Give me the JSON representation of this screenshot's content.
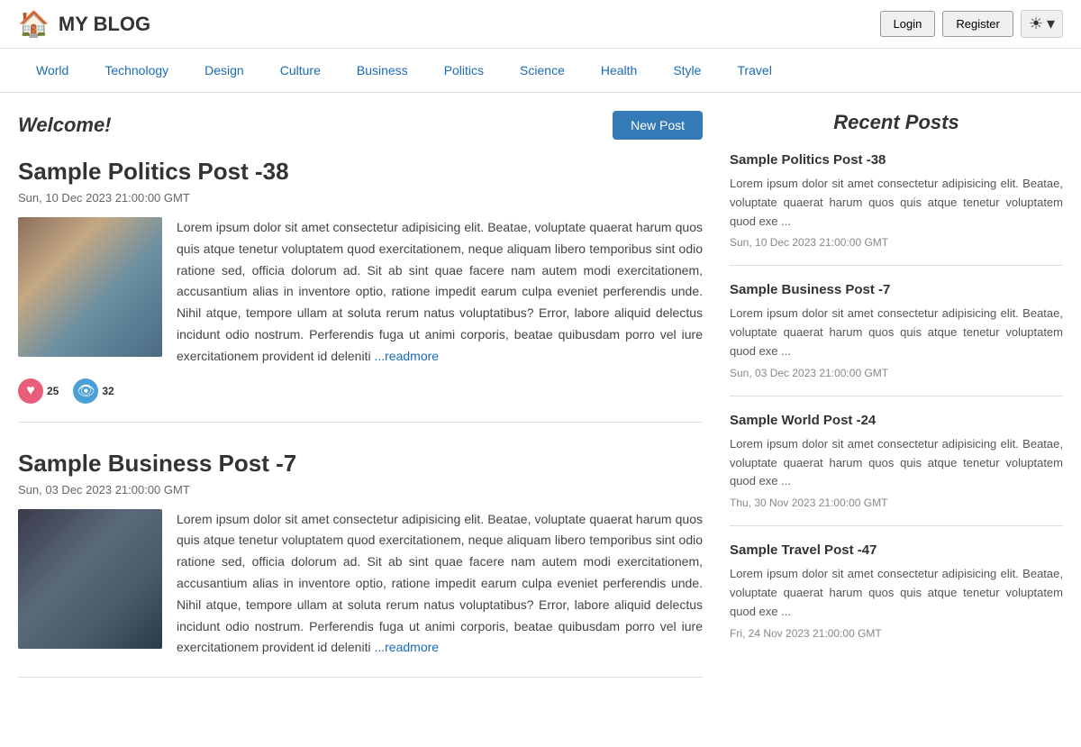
{
  "header": {
    "logo_icon": "🏠",
    "title": "MY BLOG",
    "login_label": "Login",
    "register_label": "Register",
    "theme_icon": "☀",
    "theme_chevron": "▾"
  },
  "nav": {
    "items": [
      {
        "label": "World"
      },
      {
        "label": "Technology"
      },
      {
        "label": "Design"
      },
      {
        "label": "Culture"
      },
      {
        "label": "Business"
      },
      {
        "label": "Politics"
      },
      {
        "label": "Science"
      },
      {
        "label": "Health"
      },
      {
        "label": "Style"
      },
      {
        "label": "Travel"
      }
    ]
  },
  "main": {
    "welcome": "Welcome!",
    "new_post_label": "New Post",
    "posts": [
      {
        "title": "Sample Politics Post -38",
        "date": "Sun, 10 Dec 2023 21:00:00 GMT",
        "excerpt": "Lorem ipsum dolor sit amet consectetur adipisicing elit. Beatae, voluptate quaerat harum quos quis atque tenetur voluptatem quod exercitationem, neque aliquam libero temporibus sint odio ratione sed, officia dolorum ad. Sit ab sint quae facere nam autem modi exercitationem, accusantium alias in inventore optio, ratione impedit earum culpa eveniet perferendis unde. Nihil atque, tempore ullam at soluta rerum natus voluptatibus? Error, labore aliquid delectus incidunt odio nostrum. Perferendis fuga ut animi corporis, beatae quibusdam porro vel iure exercitationem provident id deleniti",
        "readmore": "...readmore",
        "likes": "25",
        "views": "32",
        "image_type": "food"
      },
      {
        "title": "Sample Business Post -7",
        "date": "Sun, 03 Dec 2023 21:00:00 GMT",
        "excerpt": "Lorem ipsum dolor sit amet consectetur adipisicing elit. Beatae, voluptate quaerat harum quos quis atque tenetur voluptatem quod exercitationem, neque aliquam libero temporibus sint odio ratione sed, officia dolorum ad. Sit ab sint quae facere nam autem modi exercitationem, accusantium alias in inventore optio, ratione impedit earum culpa eveniet perferendis unde. Nihil atque, tempore ullam at soluta rerum natus voluptatibus? Error, labore aliquid delectus incidunt odio nostrum. Perferendis fuga ut animi corporis, beatae quibusdam porro vel iure exercitationem provident id deleniti",
        "readmore": "...readmore",
        "image_type": "tech"
      }
    ]
  },
  "sidebar": {
    "title": "Recent Posts",
    "posts": [
      {
        "title": "Sample Politics Post -38",
        "excerpt": "Lorem ipsum dolor sit amet consectetur adipisicing elit. Beatae, voluptate quaerat harum quos quis atque tenetur voluptatem quod exe ...",
        "date": "Sun, 10 Dec 2023 21:00:00 GMT"
      },
      {
        "title": "Sample Business Post -7",
        "excerpt": "Lorem ipsum dolor sit amet consectetur adipisicing elit. Beatae, voluptate quaerat harum quos quis atque tenetur voluptatem quod exe ...",
        "date": "Sun, 03 Dec 2023 21:00:00 GMT"
      },
      {
        "title": "Sample World Post -24",
        "excerpt": "Lorem ipsum dolor sit amet consectetur adipisicing elit. Beatae, voluptate quaerat harum quos quis atque tenetur voluptatem quod exe ...",
        "date": "Thu, 30 Nov 2023 21:00:00 GMT"
      },
      {
        "title": "Sample Travel Post -47",
        "excerpt": "Lorem ipsum dolor sit amet consectetur adipisicing elit. Beatae, voluptate quaerat harum quos quis atque tenetur voluptatem quod exe ...",
        "date": "Fri, 24 Nov 2023 21:00:00 GMT"
      }
    ]
  }
}
